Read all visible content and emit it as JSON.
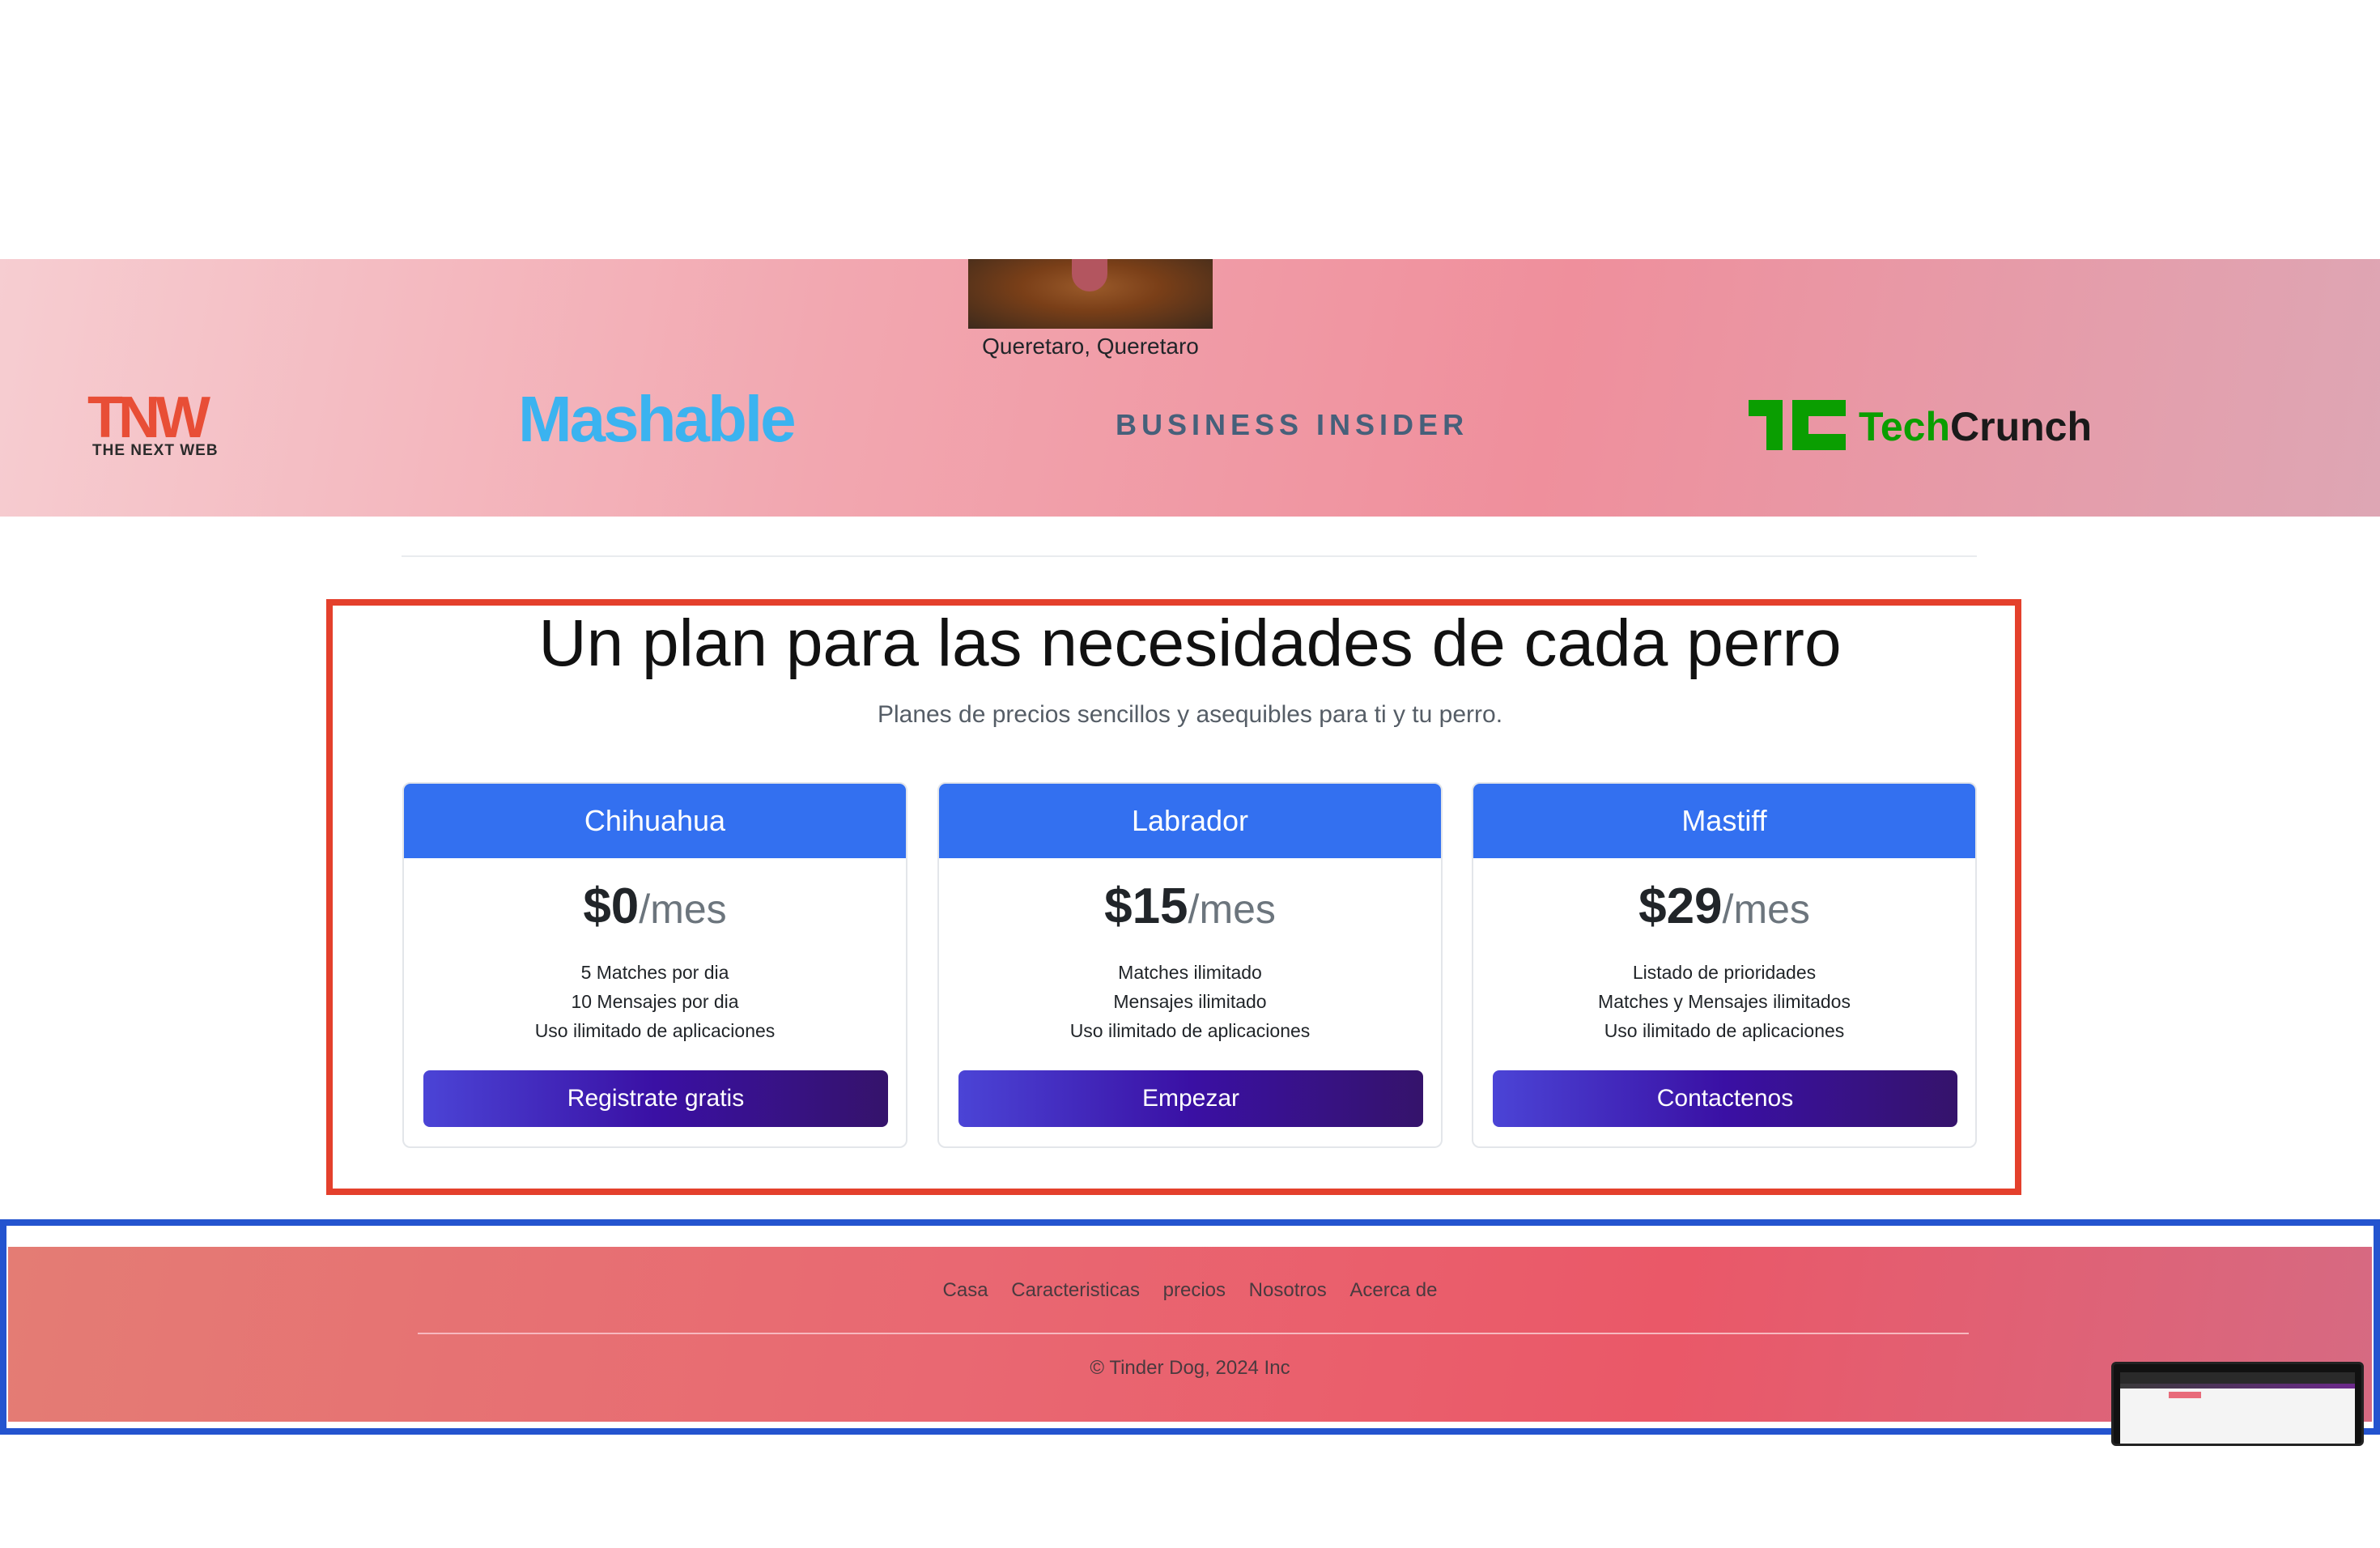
{
  "press": {
    "location": "Queretaro, Queretaro",
    "logos": {
      "tnw": "TNW",
      "tnw_sub": "THE NEXT WEB",
      "mashable": "Mashable",
      "business_insider": "BUSINESS INSIDER",
      "techcrunch_1": "Tech",
      "techcrunch_2": "Crunch"
    }
  },
  "pricing": {
    "title": "Un plan para las necesidades de cada perro",
    "subtitle": "Planes de precios sencillos y asequibles para ti y tu perro.",
    "plans": [
      {
        "name": "Chihuahua",
        "price": "$0",
        "unit": "/mes",
        "features": [
          "5 Matches por dia",
          "10 Mensajes por dia",
          "Uso ilimitado de aplicaciones"
        ],
        "button": "Registrate gratis"
      },
      {
        "name": "Labrador",
        "price": "$15",
        "unit": "/mes",
        "features": [
          "Matches ilimitado",
          "Mensajes ilimitado",
          "Uso ilimitado de aplicaciones"
        ],
        "button": "Empezar"
      },
      {
        "name": "Mastiff",
        "price": "$29",
        "unit": "/mes",
        "features": [
          "Listado de prioridades",
          "Matches y Mensajes ilimitados",
          "Uso ilimitado de aplicaciones"
        ],
        "button": "Contactenos"
      }
    ]
  },
  "footer": {
    "nav": [
      "Casa",
      "Caracteristicas",
      "precios",
      "Nosotros",
      "Acerca de"
    ],
    "copyright": "© Tinder Dog, 2024 Inc"
  },
  "colors": {
    "plan_header": "#3370f0",
    "highlight_red": "#e4402c",
    "highlight_blue": "#2454cf"
  }
}
